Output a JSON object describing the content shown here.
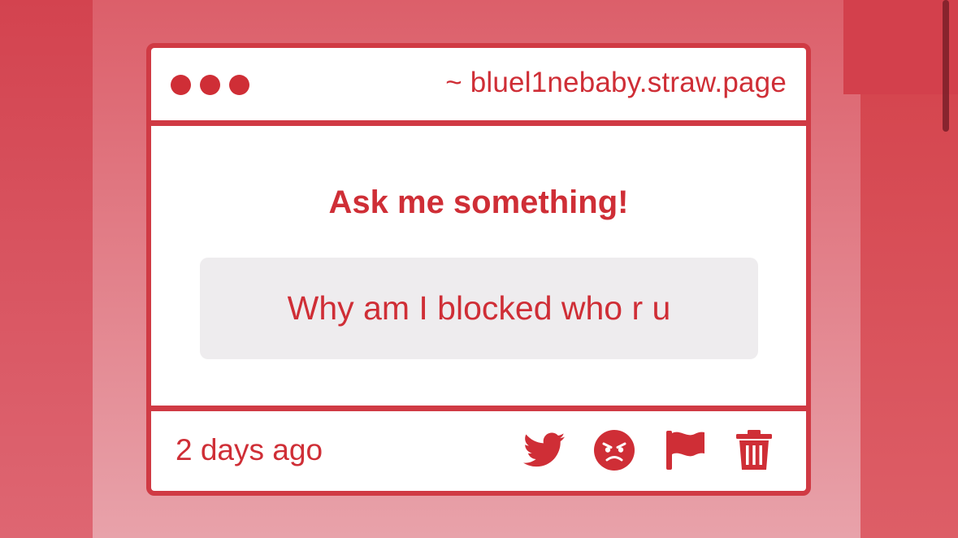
{
  "window": {
    "url": "~ bluel1nebaby.straw.page",
    "controls": [
      "window-dot",
      "window-dot",
      "window-dot"
    ]
  },
  "question_card": {
    "heading": "Ask me something!",
    "question": "Why am I blocked who r u"
  },
  "footer": {
    "timestamp": "2 days ago",
    "actions": [
      {
        "icon": "twitter-icon",
        "action": "share"
      },
      {
        "icon": "angry-face-icon",
        "action": "block"
      },
      {
        "icon": "flag-icon",
        "action": "report"
      },
      {
        "icon": "trash-icon",
        "action": "delete"
      }
    ]
  },
  "colors": {
    "accent": "#cf2e36",
    "card_border": "#d03a44",
    "question_background": "#eeecee",
    "page_background": "#dc5f6a"
  }
}
